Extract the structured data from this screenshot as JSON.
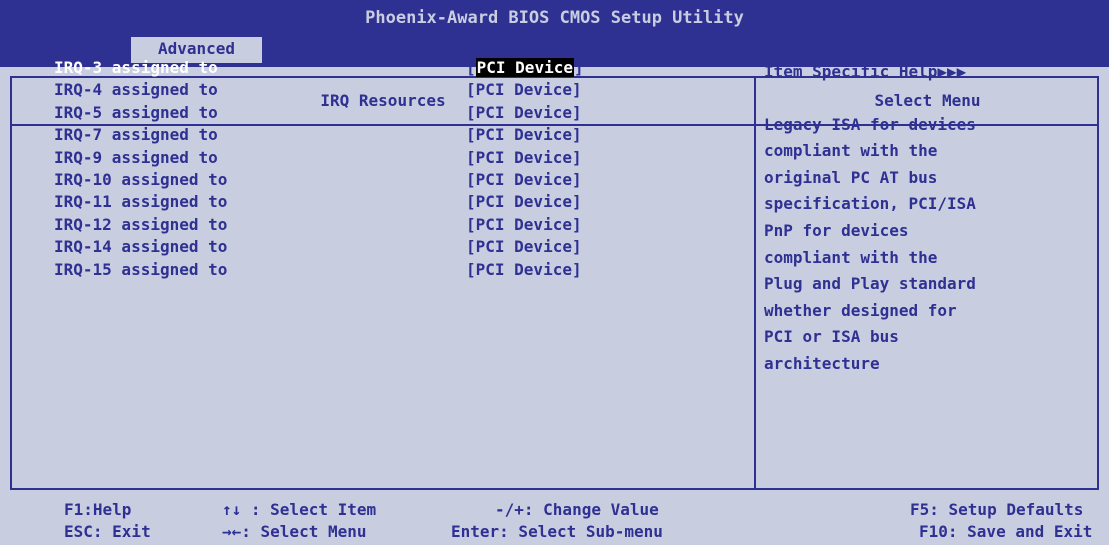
{
  "title": "Phoenix-Award BIOS CMOS Setup Utility",
  "tabs": [
    {
      "label": "Advanced",
      "active": true
    }
  ],
  "section_title": "IRQ Resources",
  "help_panel_title": "Select Menu",
  "irq_items": [
    {
      "label": "IRQ-3 assigned to",
      "value": "[PCI Device]",
      "value_inner": "PCI Device",
      "selected": true
    },
    {
      "label": "IRQ-4 assigned to",
      "value": "[PCI Device]"
    },
    {
      "label": "IRQ-5 assigned to",
      "value": "[PCI Device]"
    },
    {
      "label": "IRQ-7 assigned to",
      "value": "[PCI Device]"
    },
    {
      "label": "IRQ-9 assigned to",
      "value": "[PCI Device]"
    },
    {
      "label": "IRQ-10 assigned to",
      "value": "[PCI Device]"
    },
    {
      "label": "IRQ-11 assigned to",
      "value": "[PCI Device]"
    },
    {
      "label": "IRQ-12 assigned to",
      "value": "[PCI Device]"
    },
    {
      "label": "IRQ-14 assigned to",
      "value": "[PCI Device]"
    },
    {
      "label": "IRQ-15 assigned to",
      "value": "[PCI Device]"
    }
  ],
  "help": {
    "header": "Item Specific Help▶▶▶",
    "body": "Legacy ISA for devices\ncompliant with the\noriginal PC AT bus\nspecification, PCI/ISA\nPnP for devices\ncompliant with the\nPlug and Play standard\nwhether designed for\nPCI or ISA bus\narchitecture"
  },
  "footer": {
    "f1": "F1:Help",
    "esc": "ESC: Exit",
    "select_item": "↑↓ : Select Item",
    "select_menu": "→←: Select Menu",
    "change_value": "-/+: Change Value",
    "select_submenu": "Enter: Select Sub-menu",
    "f5": "F5: Setup Defaults",
    "f10": "F10: Save and Exit"
  },
  "colors": {
    "background": "#c9cde0",
    "foreground": "#2e3192",
    "highlight": "#ffffff",
    "selection_bg": "#000000"
  }
}
